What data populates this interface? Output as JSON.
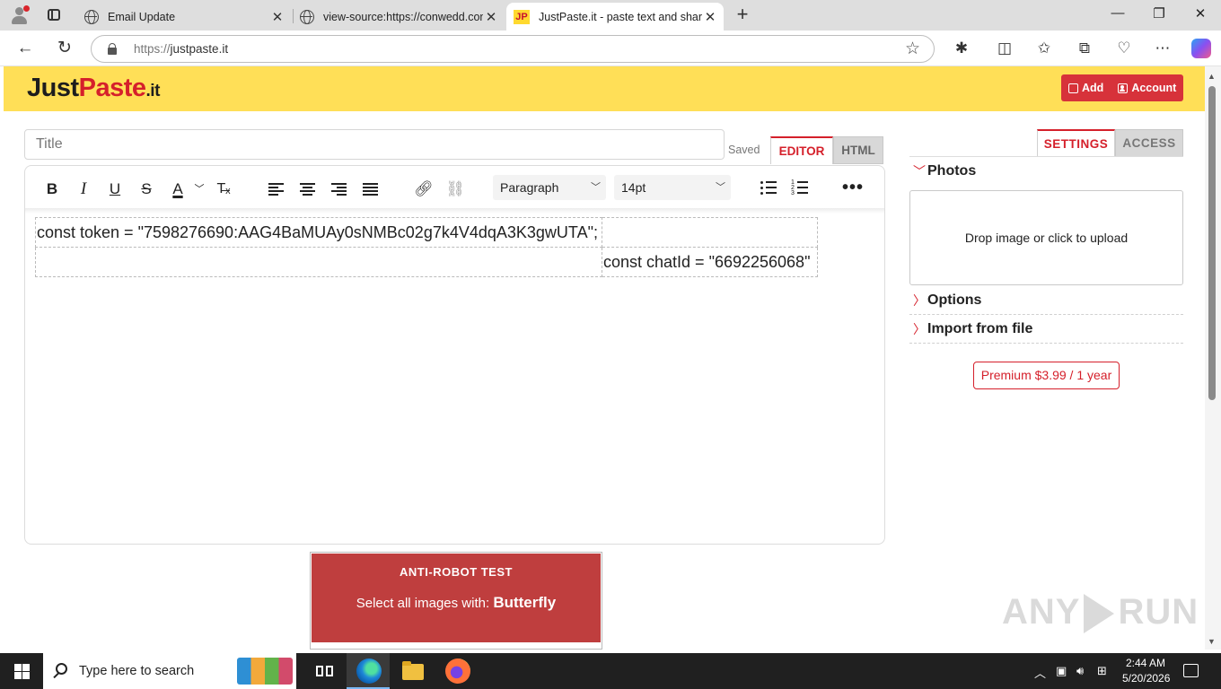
{
  "browser": {
    "tabs": [
      {
        "label": "Email Update",
        "favicon": "globe-icon",
        "active": false
      },
      {
        "label": "view-source:https://conwedd.com",
        "favicon": "globe-icon",
        "active": false
      },
      {
        "label": "JustPaste.it - paste text and share",
        "favicon": "JP",
        "active": true
      }
    ],
    "url_protocol": "https://",
    "url_host": "justpaste.it"
  },
  "site": {
    "logo_just": "Just",
    "logo_paste": "Paste",
    "logo_tld": ".it",
    "add_label": "Add",
    "account_label": "Account",
    "brand_yellow": "#ffdf57",
    "brand_red": "#d5202b"
  },
  "editor": {
    "title_placeholder": "Title",
    "saved_label": "Saved",
    "mode_tabs": [
      "EDITOR",
      "HTML"
    ],
    "block_format": "Paragraph",
    "font_size": "14pt",
    "cells": [
      [
        "const token = \"7598276690:AAG4BaMUAy0sNMBc02g7k4V4dqA3K3gwUTA\";",
        ""
      ],
      [
        "",
        "const chatId = \"6692256068\""
      ]
    ]
  },
  "sidebar": {
    "tabs": [
      "SETTINGS",
      "ACCESS"
    ],
    "photos_label": "Photos",
    "upload_label": "Drop image or click to upload",
    "options_label": "Options",
    "import_label": "Import from file",
    "premium_label": "Premium $3.99 / 1 year"
  },
  "captcha": {
    "title": "ANTI-ROBOT TEST",
    "prompt": "Select all images with:",
    "target": "Butterfly"
  },
  "watermark": {
    "left": "ANY",
    "right": "RUN"
  },
  "taskbar": {
    "search_placeholder": "Type here to search",
    "time": "2:44 AM",
    "date": "5/20/2026"
  }
}
